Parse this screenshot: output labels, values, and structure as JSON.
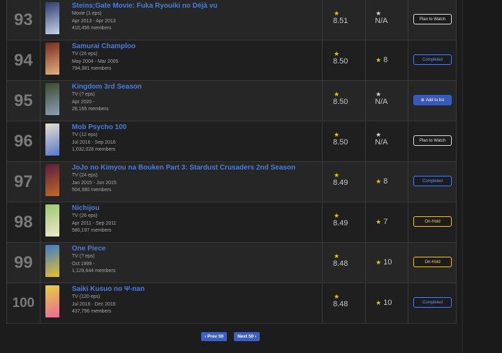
{
  "rows": [
    {
      "rank": "93",
      "title": "Steins;Gate Movie: Fuka Ryouiki no Déjà vu",
      "type": "Movie (1 eps)",
      "dates": "Apr 2013 - Apr 2013",
      "members": "410,456 members",
      "score": "8.51",
      "your_score": "N/A",
      "status": "Plan to Watch",
      "status_kind": "ptw",
      "thumb_colors": [
        "#2b3b6e",
        "#c8d2e6"
      ]
    },
    {
      "rank": "94",
      "title": "Samurai Champloo",
      "type": "TV (26 eps)",
      "dates": "May 2004 - Mar 2005",
      "members": "794,381 members",
      "score": "8.50",
      "your_score": "8",
      "status": "Completed",
      "status_kind": "comp",
      "thumb_colors": [
        "#7a2a1e",
        "#e0b080"
      ]
    },
    {
      "rank": "95",
      "title": "Kingdom 3rd Season",
      "type": "TV (? eps)",
      "dates": "Apr 2020 -",
      "members": "28,165 members",
      "score": "8.50",
      "your_score": "N/A",
      "status": "Add to list",
      "status_kind": "add",
      "thumb_colors": [
        "#3a4a2a",
        "#8aa0b8"
      ]
    },
    {
      "rank": "96",
      "title": "Mob Psycho 100",
      "type": "TV (12 eps)",
      "dates": "Jul 2016 - Sep 2016",
      "members": "1,032,028 members",
      "score": "8.50",
      "your_score": "N/A",
      "status": "Plan to Watch",
      "status_kind": "ptw",
      "thumb_colors": [
        "#e8e0d0",
        "#5a78c8"
      ]
    },
    {
      "rank": "97",
      "title": "JoJo no Kimyou na Bouken Part 3: Stardust Crusaders 2nd Season",
      "type": "TV (24 eps)",
      "dates": "Jan 2015 - Jun 2015",
      "members": "504,390 members",
      "score": "8.49",
      "your_score": "8",
      "status": "Completed",
      "status_kind": "comp",
      "thumb_colors": [
        "#5a1a3a",
        "#c06a2a"
      ]
    },
    {
      "rank": "98",
      "title": "Nichijou",
      "type": "TV (26 eps)",
      "dates": "Apr 2011 - Sep 2011",
      "members": "580,197 members",
      "score": "8.49",
      "your_score": "7",
      "status": "On-Hold",
      "status_kind": "hold",
      "thumb_colors": [
        "#9cc86a",
        "#f0e8d0"
      ]
    },
    {
      "rank": "99",
      "title": "One Piece",
      "type": "TV (? eps)",
      "dates": "Oct 1999 -",
      "members": "1,129,644 members",
      "score": "8.48",
      "your_score": "10",
      "status": "On-Hold",
      "status_kind": "hold",
      "thumb_colors": [
        "#3a7ac8",
        "#e8c030"
      ]
    },
    {
      "rank": "100",
      "title": "Saiki Kusuo no Ψ-nan",
      "type": "TV (120 eps)",
      "dates": "Jul 2016 - Dec 2016",
      "members": "437,796 members",
      "score": "8.48",
      "your_score": "10",
      "status": "Completed",
      "status_kind": "comp",
      "thumb_colors": [
        "#e8d040",
        "#e86a9a"
      ]
    }
  ],
  "pager": {
    "prev": "‹ Prev 50",
    "next": "Next 50 ›"
  },
  "icons": {
    "star": "star-icon",
    "plus": "plus-circle-icon"
  }
}
